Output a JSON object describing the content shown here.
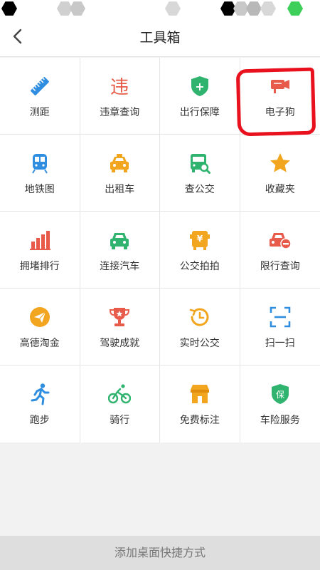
{
  "header": {
    "title": "工具箱"
  },
  "tools": [
    {
      "label": "测距",
      "icon": "ruler-icon"
    },
    {
      "label": "违章查询",
      "icon": "violation-icon",
      "glyph": "违"
    },
    {
      "label": "出行保障",
      "icon": "shield-plus-icon",
      "glyph": "+"
    },
    {
      "label": "电子狗",
      "icon": "camera-icon"
    },
    {
      "label": "地铁图",
      "icon": "subway-icon"
    },
    {
      "label": "出租车",
      "icon": "taxi-icon"
    },
    {
      "label": "查公交",
      "icon": "bus-search-icon"
    },
    {
      "label": "收藏夹",
      "icon": "star-icon"
    },
    {
      "label": "拥堵排行",
      "icon": "bar-chart-icon"
    },
    {
      "label": "连接汽车",
      "icon": "car-icon"
    },
    {
      "label": "公交拍拍",
      "icon": "bus-yuan-icon",
      "glyph": "¥"
    },
    {
      "label": "限行查询",
      "icon": "car-restrict-icon"
    },
    {
      "label": "高德淘金",
      "icon": "paper-plane-icon"
    },
    {
      "label": "驾驶成就",
      "icon": "trophy-icon"
    },
    {
      "label": "实时公交",
      "icon": "clock-icon"
    },
    {
      "label": "扫一扫",
      "icon": "scan-icon"
    },
    {
      "label": "跑步",
      "icon": "runner-icon"
    },
    {
      "label": "骑行",
      "icon": "bicycle-icon"
    },
    {
      "label": "免费标注",
      "icon": "shop-icon"
    },
    {
      "label": "车险服务",
      "icon": "insurance-icon",
      "glyph": "保"
    }
  ],
  "bottom_bar": {
    "label": "添加桌面快捷方式"
  },
  "colors": {
    "accent_red": "#e8111d",
    "bg": "#f2f2f2"
  }
}
